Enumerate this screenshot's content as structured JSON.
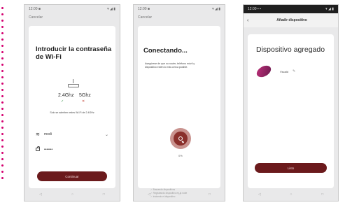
{
  "screens": [
    {
      "status_left": "12:00 ■",
      "status_right": "▾ ◢ ▮",
      "top_link": "Cancelar",
      "title": "Introducir la contraseña de Wi-Fi",
      "band_24": "2.4Ghz",
      "band_24_mark": "✓",
      "band_5": "5Ghz",
      "band_5_mark": "✕",
      "note": "Solo se admiten redes Wi-Fi de 2.4GHz",
      "wifi_value": "modi",
      "password_mask": "•••••••",
      "button": "Continuar"
    },
    {
      "status_left": "12:00 ■",
      "status_right": "▾ ◢ ▮",
      "top_link": "Cancelar",
      "title": "Conectando...",
      "note": "Asegúrese de que su router, teléfono móvil y dispositivo estén lo más cerca posible.",
      "progress": "0%",
      "steps": [
        "Buscando dispositivos",
        "Registrando dispositivo en la nube",
        "Iniciando el dispositivo"
      ]
    },
    {
      "status_left": "12:00 ▪ ▪",
      "status_right": "▾ ◢ ▮",
      "appbar_title": "Añadir dispositivo",
      "title": "Dispositivo agregado",
      "device_name": "Vscald",
      "button": "Listo"
    }
  ],
  "navbar": [
    "◁",
    "○",
    "□"
  ],
  "colors": {
    "accent": "#6b1a1c",
    "device": "#c0307a",
    "decoration": "#d4006f"
  }
}
